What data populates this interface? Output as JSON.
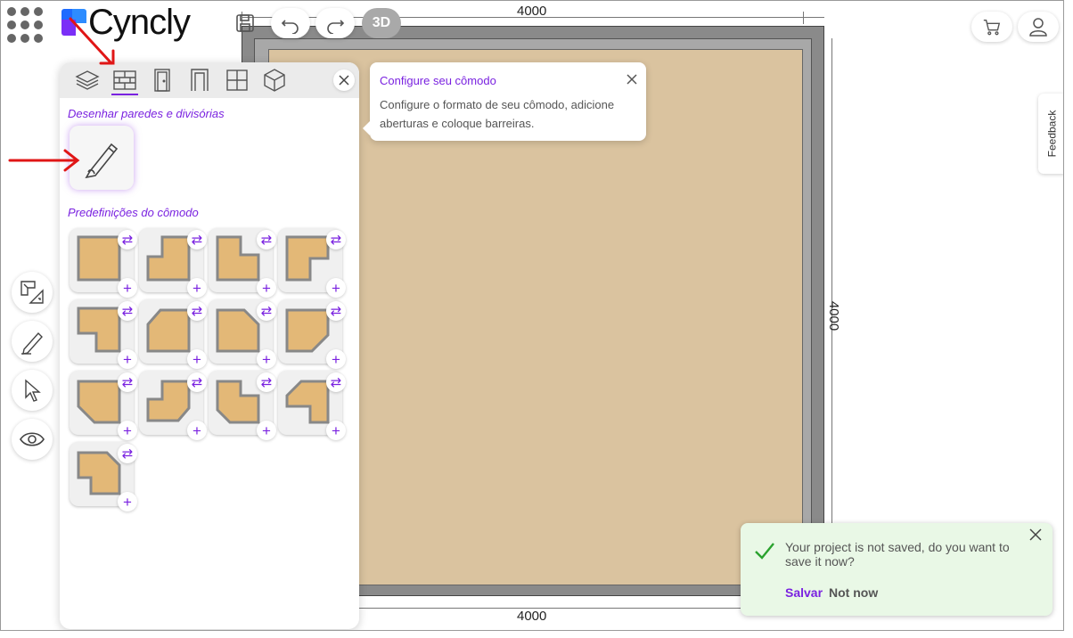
{
  "app": {
    "brand_name": "Cyncly",
    "brand_colors": {
      "blue": "#1e6bff",
      "purple": "#7b2ff7"
    }
  },
  "toolbar": {
    "view_3d_label": "3D"
  },
  "canvas": {
    "room_width_label_top": "4000",
    "room_width_label_bottom": "4000",
    "room_depth_label": "4000",
    "floor_color": "#dac39f"
  },
  "panel": {
    "tabs": [
      {
        "name": "layers",
        "icon": "layers-icon",
        "active": false
      },
      {
        "name": "walls",
        "icon": "wall-icon",
        "active": true
      },
      {
        "name": "doors",
        "icon": "door-icon",
        "active": false
      },
      {
        "name": "openings",
        "icon": "opening-icon",
        "active": false
      },
      {
        "name": "windows",
        "icon": "window-icon",
        "active": false
      },
      {
        "name": "objects",
        "icon": "cube-icon",
        "active": false
      }
    ],
    "draw_section_title": "Desenhar paredes e divisórias",
    "presets_section_title": "Predefinições do cômodo",
    "preset_count": 13,
    "accent_color": "#7a22e0"
  },
  "tooltip": {
    "title": "Configure seu cômodo",
    "body": "Configure o formato de seu cômodo, adicione aberturas e coloque barreiras."
  },
  "feedback_label": "Feedback",
  "toast": {
    "message": "Your project is not saved, do you want to save it now?",
    "save_label": "Salvar",
    "not_now_label": "Not now"
  }
}
